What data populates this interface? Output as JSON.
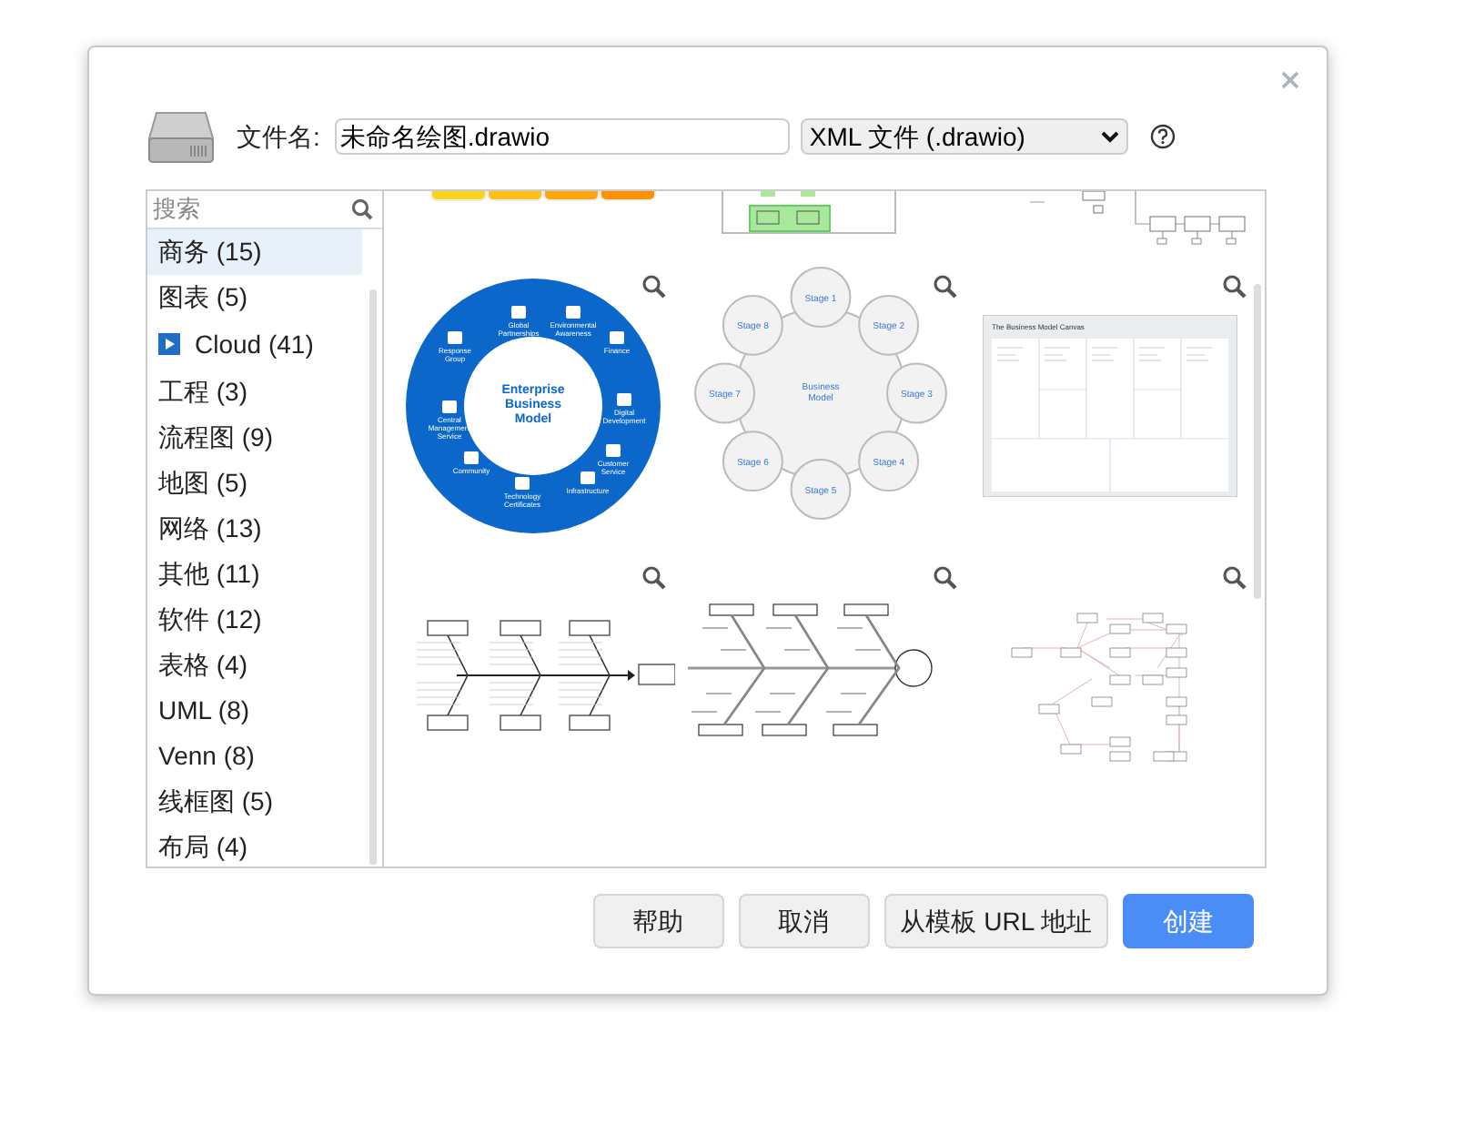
{
  "file_name_label": "文件名:",
  "file_name": "未命名绘图.drawio",
  "format": "XML 文件 (.drawio)",
  "search": {
    "placeholder": "搜索"
  },
  "categories": [
    {
      "label": "商务 (15)",
      "selected": true,
      "kind": "plain"
    },
    {
      "label": "图表 (5)",
      "selected": false,
      "kind": "plain"
    },
    {
      "label": "Cloud (41)",
      "selected": false,
      "kind": "with_icon"
    },
    {
      "label": "工程 (3)",
      "selected": false,
      "kind": "plain"
    },
    {
      "label": "流程图 (9)",
      "selected": false,
      "kind": "plain"
    },
    {
      "label": "地图 (5)",
      "selected": false,
      "kind": "plain"
    },
    {
      "label": "网络 (13)",
      "selected": false,
      "kind": "plain"
    },
    {
      "label": "其他 (11)",
      "selected": false,
      "kind": "plain"
    },
    {
      "label": "软件 (12)",
      "selected": false,
      "kind": "plain"
    },
    {
      "label": "表格 (4)",
      "selected": false,
      "kind": "plain"
    },
    {
      "label": "UML (8)",
      "selected": false,
      "kind": "plain"
    },
    {
      "label": "Venn (8)",
      "selected": false,
      "kind": "plain"
    },
    {
      "label": "线框图 (5)",
      "selected": false,
      "kind": "plain"
    },
    {
      "label": "布局 (4)",
      "selected": false,
      "kind": "plain"
    }
  ],
  "templates": [
    {
      "kind": "steps_cut"
    },
    {
      "kind": "swimlane_cut"
    },
    {
      "kind": "flow_cut"
    },
    {
      "kind": "donut",
      "title": [
        "Enterprise",
        "Business",
        "Model"
      ],
      "labels": [
        "Global Partnerships",
        "Environmental Awareness",
        "Response Group",
        "Finance",
        "Central Management Service",
        "Digital Development",
        "Community",
        "Customer Service",
        "Technology Certificates",
        "Infrastructure"
      ]
    },
    {
      "kind": "stages",
      "center": "Business Model",
      "stages": [
        "Stage 1",
        "Stage 8",
        "Stage 2",
        "Stage 7",
        "Stage 3",
        "Stage 6",
        "Stage 4",
        "Stage 5"
      ]
    },
    {
      "kind": "canvas",
      "title": "The Business Model Canvas"
    },
    {
      "kind": "fishbone"
    },
    {
      "kind": "fishbone_circle"
    },
    {
      "kind": "network"
    }
  ],
  "buttons": [
    {
      "label": "帮助",
      "primary": false
    },
    {
      "label": "取消",
      "primary": false
    },
    {
      "label": "从模板 URL 地址",
      "primary": false
    },
    {
      "label": "创建",
      "primary": true
    }
  ]
}
